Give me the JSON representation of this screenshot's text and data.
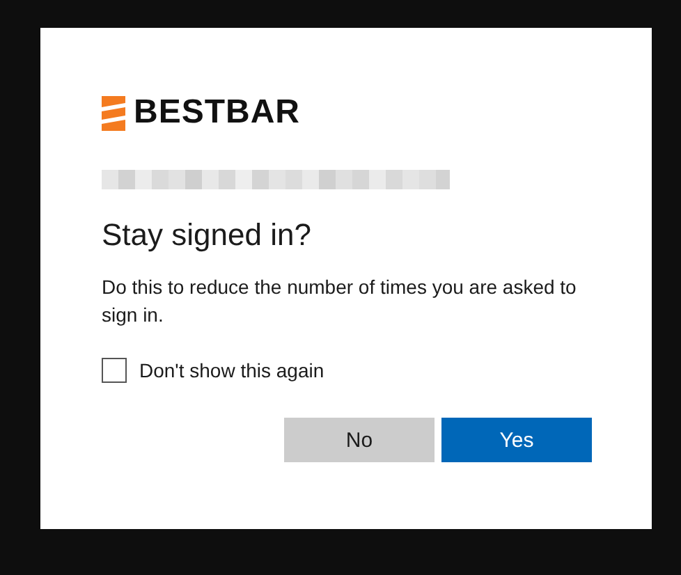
{
  "logo": {
    "name": "BESTBAR"
  },
  "title": "Stay signed in?",
  "description": "Do this to reduce the number of times you are asked to sign in.",
  "checkbox": {
    "label": "Don't show this again",
    "checked": false
  },
  "buttons": [
    {
      "label": "No",
      "kind": "secondary"
    },
    {
      "label": "Yes",
      "kind": "primary"
    }
  ]
}
